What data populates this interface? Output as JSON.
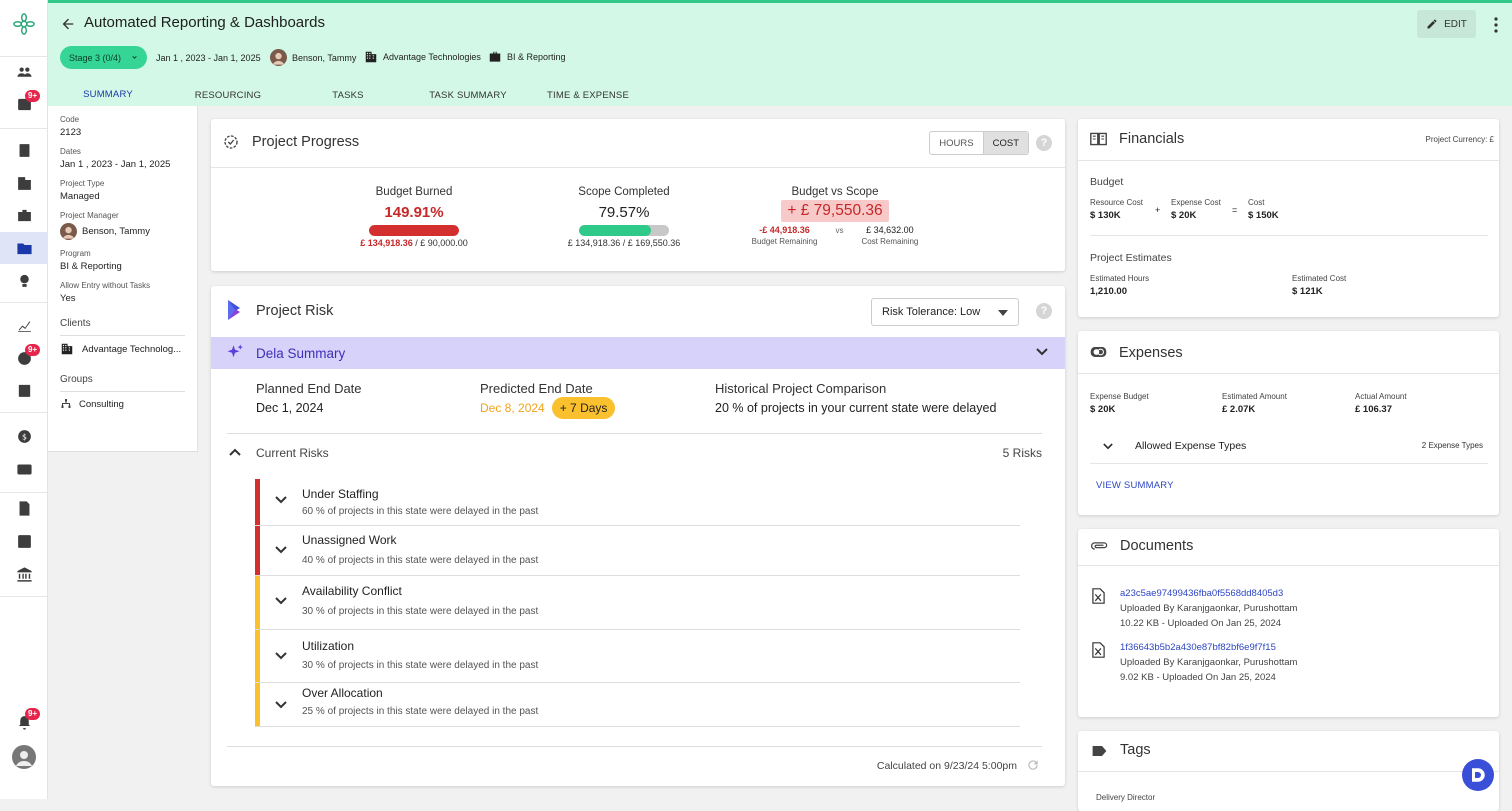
{
  "nav": {
    "badge1": "9+",
    "badge2": "9+",
    "badge3": "9+"
  },
  "header": {
    "title": "Automated Reporting & Dashboards",
    "edit_label": "EDIT",
    "stage": "Stage 3 (0/4)",
    "dates": "Jan 1 , 2023 - Jan 1, 2025",
    "manager": "Benson, Tammy",
    "client": "Advantage Technologies",
    "program": "BI & Reporting"
  },
  "tabs": [
    "SUMMARY",
    "RESOURCING",
    "TASKS",
    "TASK SUMMARY",
    "TIME & EXPENSE"
  ],
  "details": {
    "code_label": "Code",
    "code": "2123",
    "dates_label": "Dates",
    "dates": "Jan 1 , 2023 - Jan 1, 2025",
    "type_label": "Project Type",
    "type": "Managed",
    "pm_label": "Project Manager",
    "pm": "Benson, Tammy",
    "program_label": "Program",
    "program": "BI & Reporting",
    "allow_label": "Allow Entry without Tasks",
    "allow": "Yes",
    "clients_label": "Clients",
    "client": "Advantage Technolog...",
    "groups_label": "Groups",
    "group": "Consulting"
  },
  "progress": {
    "title": "Project Progress",
    "hours": "HOURS",
    "cost": "COST",
    "budget_burned": {
      "title": "Budget Burned",
      "value": "149.91%",
      "pct": 1.0,
      "amount": "£ 134,918.36",
      "total": "/ £ 90,000.00"
    },
    "scope": {
      "title": "Scope Completed",
      "value": "79.57%",
      "pct": 0.7957,
      "sub": "£ 134,918.36 / £ 169,550.36"
    },
    "bvs": {
      "title": "Budget vs Scope",
      "value": "+ £ 79,550.36",
      "left": "-£ 44,918.36",
      "vs": "vs",
      "right": "£ 34,632.00",
      "left_label": "Budget Remaining",
      "right_label": "Cost Remaining"
    }
  },
  "risk": {
    "title": "Project Risk",
    "tolerance": "Risk Tolerance: Low",
    "dela": "Dela Summary",
    "planned_label": "Planned End Date",
    "planned": "Dec 1, 2024",
    "predicted_label": "Predicted End Date",
    "predicted": "Dec 8, 2024",
    "delay": "+ 7 Days",
    "hist_label": "Historical Project Comparison",
    "hist": "20 % of projects in your current state were delayed",
    "current": "Current Risks",
    "count": "5 Risks",
    "items": [
      {
        "title": "Under Staffing",
        "desc": "60 % of projects in this state were delayed in the past",
        "color": "#d32f2f"
      },
      {
        "title": "Unassigned Work",
        "desc": "40 % of projects in this state were delayed in the past",
        "color": "#d32f2f"
      },
      {
        "title": "Availability Conflict",
        "desc": "30 % of projects in this state were delayed in the past",
        "color": "#fbc02d"
      },
      {
        "title": "Utilization",
        "desc": "30 % of projects in this state were delayed in the past",
        "color": "#fbc02d"
      },
      {
        "title": "Over Allocation",
        "desc": "25 % of projects in this state were delayed in the past",
        "color": "#fbc02d"
      }
    ],
    "calculated": "Calculated on 9/23/24 5:00pm"
  },
  "financials": {
    "title": "Financials",
    "currency": "Project Currency: £",
    "budget": "Budget",
    "resource_label": "Resource Cost",
    "resource": "$ 130K",
    "plus": "+",
    "expense_label": "Expense Cost",
    "expense": "$ 20K",
    "eq": "=",
    "cost_label": "Cost",
    "cost": "$ 150K",
    "estimates": "Project Estimates",
    "est_hours_label": "Estimated Hours",
    "est_hours": "1,210.00",
    "est_cost_label": "Estimated Cost",
    "est_cost": "$ 121K"
  },
  "expenses": {
    "title": "Expenses",
    "budget_label": "Expense Budget",
    "budget": "$ 20K",
    "est_label": "Estimated Amount",
    "est": "£ 2.07K",
    "actual_label": "Actual Amount",
    "actual": "£ 106.37",
    "allowed": "Allowed Expense Types",
    "allowed_count": "2 Expense Types",
    "view": "VIEW SUMMARY"
  },
  "documents": {
    "title": "Documents",
    "items": [
      {
        "name": "a23c5ae97499436fba0f5568dd8405d3",
        "by": "Uploaded By Karanjgaonkar, Purushottam",
        "meta": "10.22 KB - Uploaded On Jan 25, 2024"
      },
      {
        "name": "1f36643b5b2a430e87bf82bf6e9f7f15",
        "by": "Uploaded By Karanjgaonkar, Purushottam",
        "meta": "9.02 KB - Uploaded On Jan 25, 2024"
      }
    ]
  },
  "tags": {
    "title": "Tags",
    "first": "Delivery Director"
  },
  "colors": {
    "accent": "#2d46c1",
    "header_bg": "#d3f8e8",
    "stage": "#35d596",
    "danger": "#c62828",
    "warn": "#fbc02d"
  }
}
